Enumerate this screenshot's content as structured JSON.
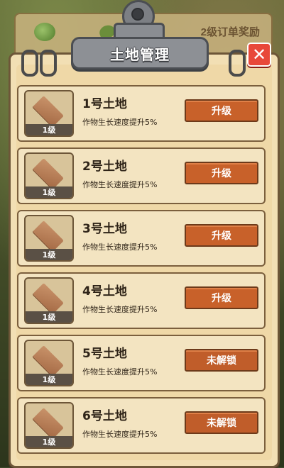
{
  "background": {
    "reward_text": "2级订单奖励"
  },
  "dialog": {
    "title": "土地管理",
    "close_label": "✕"
  },
  "lands": [
    {
      "name": "1号土地",
      "level": "1级",
      "desc": "作物生长速度提升5%",
      "action": "升级",
      "locked": false
    },
    {
      "name": "2号土地",
      "level": "1级",
      "desc": "作物生长速度提升5%",
      "action": "升级",
      "locked": false
    },
    {
      "name": "3号土地",
      "level": "1级",
      "desc": "作物生长速度提升5%",
      "action": "升级",
      "locked": false
    },
    {
      "name": "4号土地",
      "level": "1级",
      "desc": "作物生长速度提升5%",
      "action": "升级",
      "locked": false
    },
    {
      "name": "5号土地",
      "level": "1级",
      "desc": "作物生长速度提升5%",
      "action": "未解锁",
      "locked": true
    },
    {
      "name": "6号土地",
      "level": "1级",
      "desc": "作物生长速度提升5%",
      "action": "未解锁",
      "locked": true
    }
  ],
  "colors": {
    "button": "#c8612a",
    "close": "#e8483a",
    "paper": "#f2dfb4"
  }
}
